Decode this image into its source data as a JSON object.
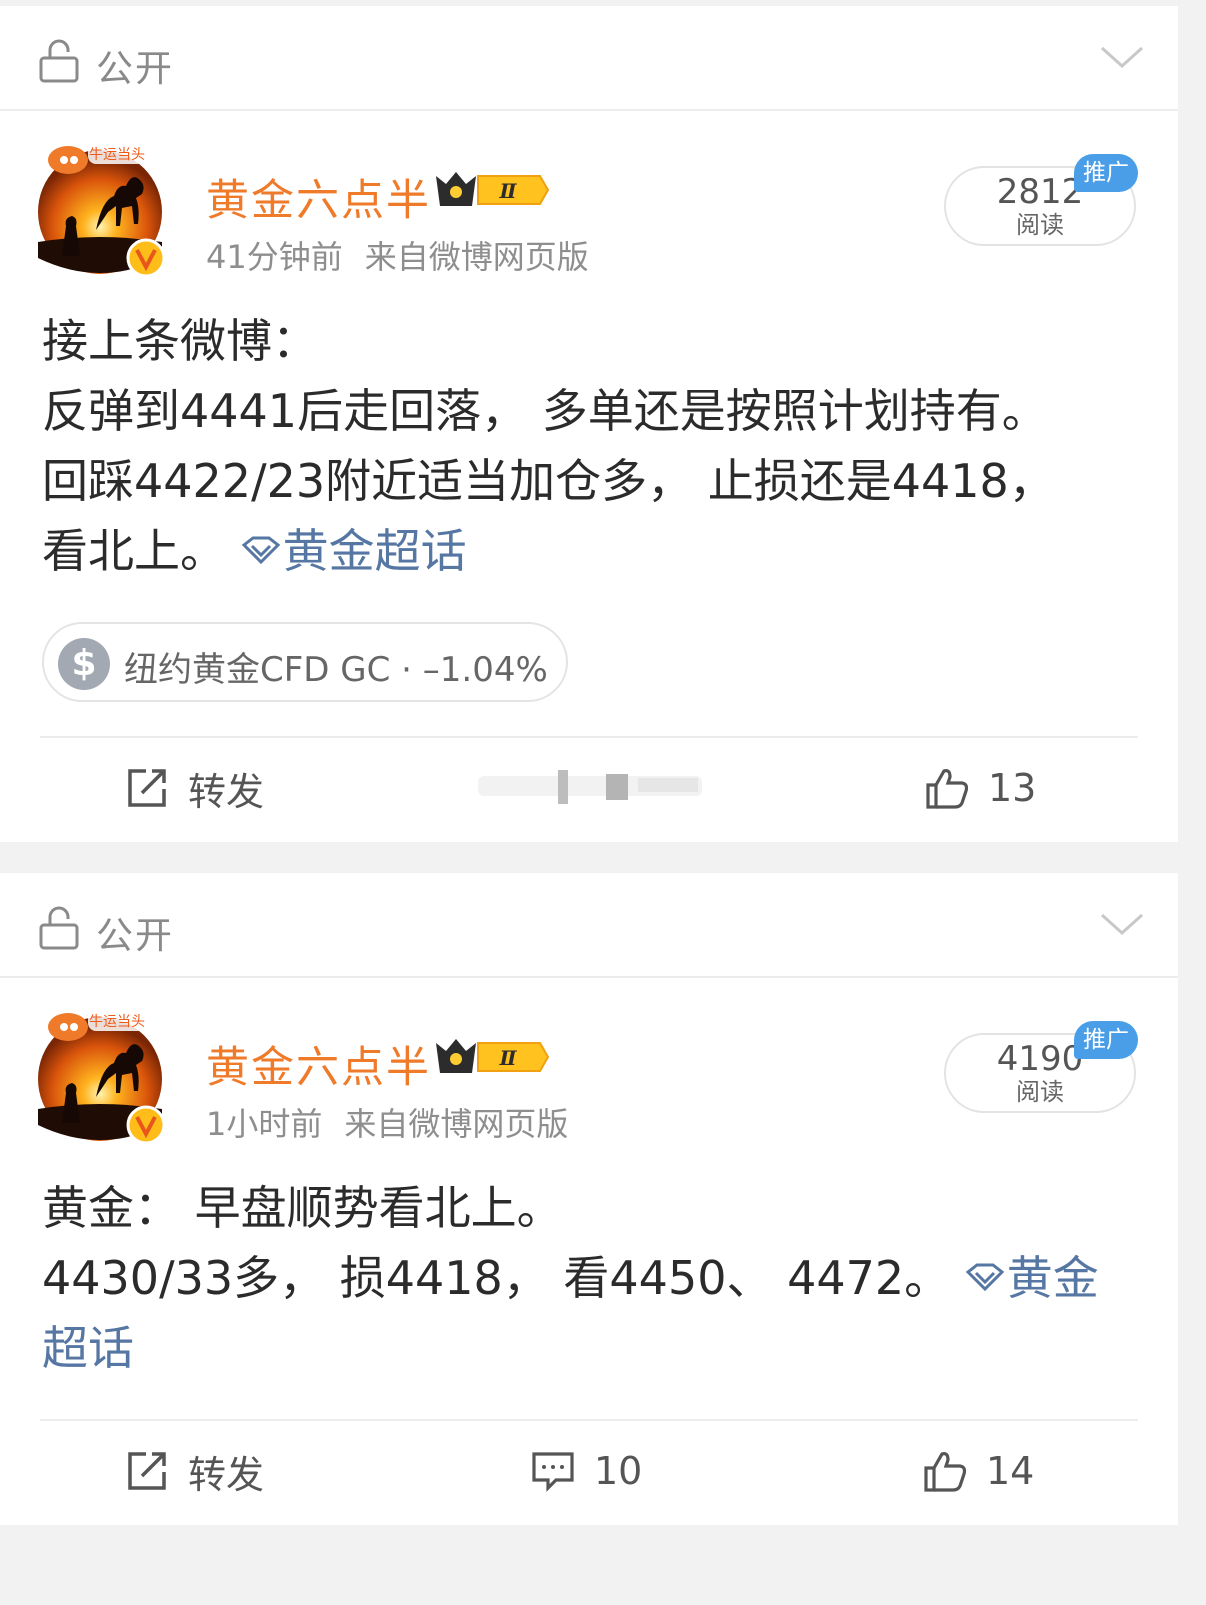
{
  "posts": [
    {
      "privacy": "公开",
      "author": "黄金六点半",
      "level": "II",
      "time": "41分钟前",
      "source": "来自微博网页版",
      "reads_count": "2812",
      "reads_label": "阅读",
      "promo": "推广",
      "lines": [
        "接上条微博：",
        "反弹到4441后走回落， 多单还是按照计划持有。",
        "回踩4422/23附近适当加仓多， 止损还是4418，",
        "看北上。"
      ],
      "topic": "黄金超话",
      "stock": "纽约黄金CFD GC · –1.04%",
      "repost": "转发",
      "likes": "13"
    },
    {
      "privacy": "公开",
      "author": "黄金六点半",
      "level": "II",
      "time": "1小时前",
      "source": "来自微博网页版",
      "reads_count": "4190",
      "reads_label": "阅读",
      "promo": "推广",
      "lines": [
        "黄金： 早盘顺势看北上。",
        "4430/33多， 损4418， 看4450、 4472。"
      ],
      "topic_a": "黄金",
      "topic_b": "超话",
      "repost": "转发",
      "comments": "10",
      "likes": "14"
    }
  ],
  "colors": {
    "author": "#ee7a2a",
    "topic": "#5677a3",
    "promo": "#4a9ee8",
    "background": "#f2f2f2"
  }
}
